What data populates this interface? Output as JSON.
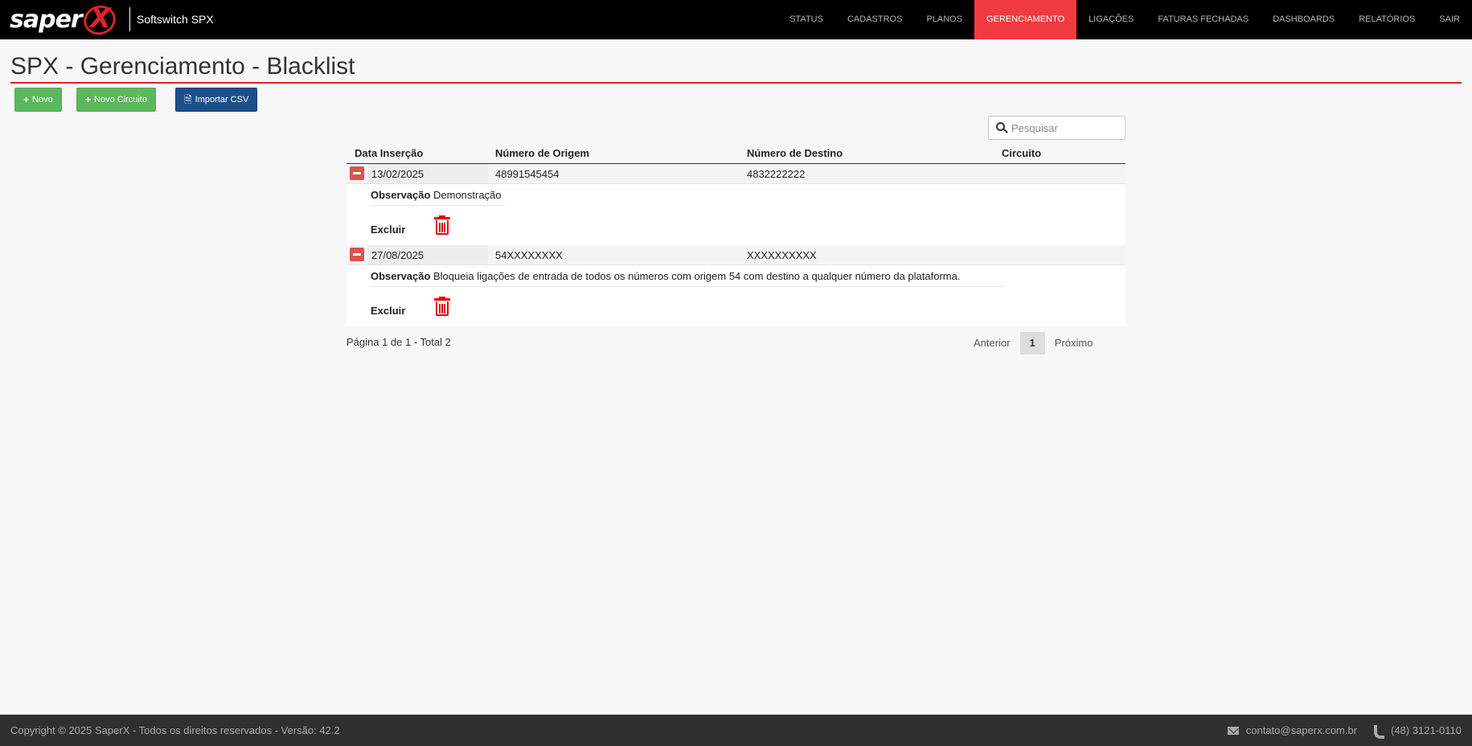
{
  "brand": {
    "logo_text": "saper",
    "logo_mark": "X",
    "product": "Softswitch SPX"
  },
  "nav": {
    "items": [
      "STATUS",
      "CADASTROS",
      "PLANOS",
      "GERENCIAMENTO",
      "LIGAÇÕES",
      "FATURAS FECHADAS",
      "DASHBOARDS",
      "RELATÓRIOS",
      "SAIR"
    ],
    "active": "GERENCIAMENTO"
  },
  "page": {
    "title": "SPX - Gerenciamento - Blacklist"
  },
  "toolbar": {
    "new_label": "Novo",
    "new_circuit_label": "Novo Circuito",
    "import_label": "Importar CSV"
  },
  "search": {
    "placeholder": "Pesquisar",
    "value": ""
  },
  "table": {
    "columns": [
      "Data Inserção",
      "Número de Origem",
      "Número de Destino",
      "Circuito"
    ],
    "rows": [
      {
        "date": "13/02/2025",
        "origin": "48991545454",
        "destination": "4832222222",
        "circuit": "",
        "obs_label": "Observação",
        "obs_value": "Demonstração",
        "delete_label": "Excluir"
      },
      {
        "date": "27/08/2025",
        "origin": "54XXXXXXXX",
        "destination": "XXXXXXXXXX",
        "circuit": "",
        "obs_label": "Observação",
        "obs_value": "Bloqueia ligações de entrada de todos os números com origem 54 com destino a qualquer número da plataforma.",
        "delete_label": "Excluir"
      }
    ]
  },
  "pagination": {
    "info": "Página 1 de 1 - Total 2",
    "prev": "Anterior",
    "current": "1",
    "next": "Próximo"
  },
  "footer": {
    "copyright": "Copyright © 2025 SaperX - Todos os direitos reservados - Versão: 42.2",
    "email": "contato@saperx.com.br",
    "phone": "(48) 3121-0110"
  },
  "colors": {
    "accent_red": "#ef3b3f",
    "button_green": "#5cb85c",
    "button_blue": "#1b4f8a",
    "footer_bg": "#2f2f2f"
  }
}
